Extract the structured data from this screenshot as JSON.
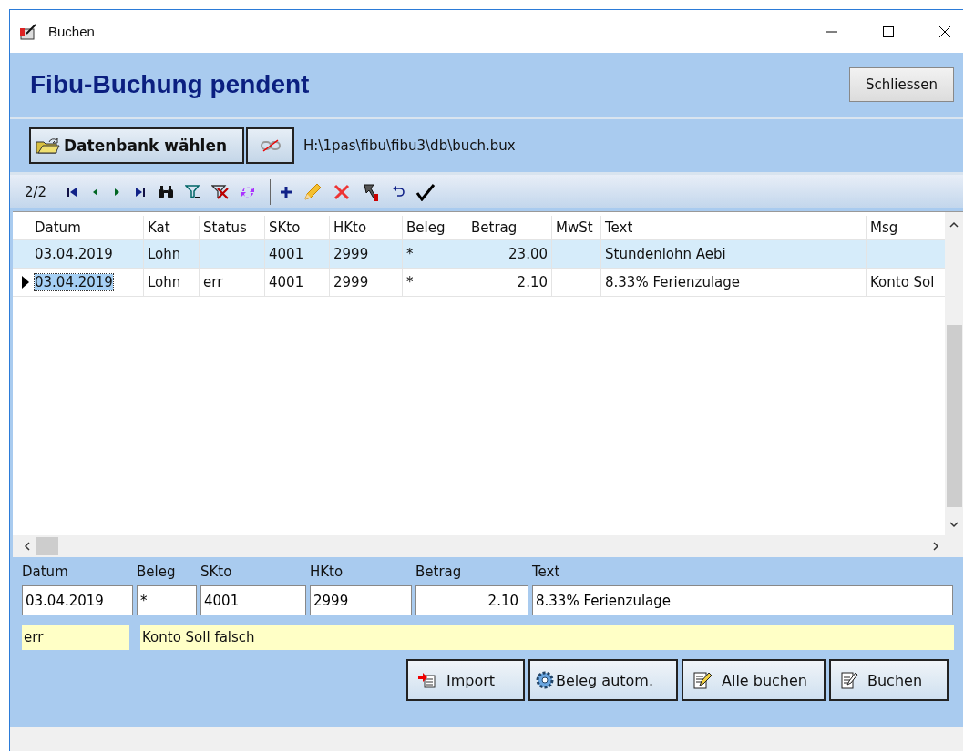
{
  "window": {
    "title": "Buchen"
  },
  "header": {
    "title": "Fibu-Buchung pendent",
    "close_button": "Schliessen"
  },
  "database": {
    "button": "Datenbank wählen",
    "path": "H:\\1pas\\fibu\\fibu3\\db\\buch.bux"
  },
  "toolbar": {
    "record_counter": "2/2"
  },
  "table": {
    "columns": [
      "Datum",
      "Kat",
      "Status",
      "SKto",
      "HKto",
      "Beleg",
      "Betrag",
      "MwSt",
      "Text",
      "Msg"
    ],
    "rows": [
      {
        "selected": true,
        "current": false,
        "cells": [
          "03.04.2019",
          "Lohn",
          "",
          "4001",
          "2999",
          "*",
          "23.00",
          "",
          "Stundenlohn Aebi",
          ""
        ]
      },
      {
        "selected": false,
        "current": true,
        "cells": [
          "03.04.2019",
          "Lohn",
          "err",
          "4001",
          "2999",
          "*",
          "2.10",
          "",
          "8.33% Ferienzulage",
          "Konto Sol"
        ]
      }
    ]
  },
  "detail": {
    "fields": [
      {
        "label": "Datum",
        "value": "03.04.2019",
        "kind": "text"
      },
      {
        "label": "Beleg",
        "value": "*",
        "kind": "text"
      },
      {
        "label": "SKto",
        "value": "4001",
        "kind": "text"
      },
      {
        "label": "HKto",
        "value": "2999",
        "kind": "text"
      },
      {
        "label": "Betrag",
        "value": "2.10",
        "kind": "amount"
      },
      {
        "label": "Text",
        "value": "8.33% Ferienzulage",
        "kind": "text"
      }
    ],
    "status": "err",
    "message": "Konto Soll falsch"
  },
  "buttons": [
    {
      "label": "Import",
      "kind": "import"
    },
    {
      "label": "Beleg autom.",
      "kind": "gear"
    },
    {
      "label": "Alle buchen",
      "kind": "book-all"
    },
    {
      "label": "Buchen",
      "kind": "book"
    }
  ]
}
